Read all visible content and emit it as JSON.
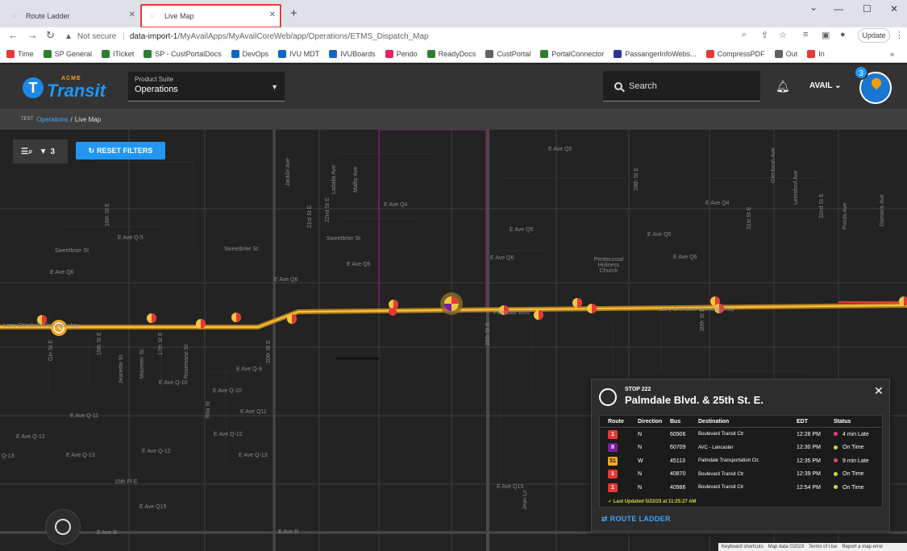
{
  "browser": {
    "tabs": [
      {
        "label": "Route Ladder"
      },
      {
        "label": "Live Map"
      }
    ],
    "new_tab_icon": "+",
    "security_label": "Not secure",
    "url_host": "data-import-1",
    "url_path": "/MyAvailApps/MyAvailCoreWeb/app/Operations/ETMS_Dispatch_Map",
    "update_label": "Update",
    "bookmarks": [
      {
        "label": "Time",
        "color": "#e53935"
      },
      {
        "label": "SP General",
        "color": "#2e7d32"
      },
      {
        "label": "ITicket",
        "color": "#2e7d32"
      },
      {
        "label": "SP - CustPortalDocs",
        "color": "#2e7d32"
      },
      {
        "label": "DevOps",
        "color": "#1565c0"
      },
      {
        "label": "IVU MDT",
        "color": "#1565c0"
      },
      {
        "label": "IVUBoards",
        "color": "#1565c0"
      },
      {
        "label": "Pendo",
        "color": "#e91e63"
      },
      {
        "label": "ReadyDocs",
        "color": "#2e7d32"
      },
      {
        "label": "CustPortal",
        "color": "#616161"
      },
      {
        "label": "PortalConnector",
        "color": "#2e7d32"
      },
      {
        "label": "PassangerInfoWebs...",
        "color": "#283593"
      },
      {
        "label": "CompressPDF",
        "color": "#e53935"
      },
      {
        "label": "Out",
        "color": "#616161"
      },
      {
        "label": "In",
        "color": "#e53935"
      }
    ],
    "more_bookmarks": "»"
  },
  "header": {
    "logo_top": "ACME",
    "logo_main": "Transit",
    "suite_label": "Product Suite",
    "suite_value": "Operations",
    "search_placeholder": "Search",
    "user_label": "AVAIL",
    "notification_count": "3"
  },
  "breadcrumb": {
    "env": "TEST",
    "parent": "Operations",
    "separator": "/",
    "current": "Live Map"
  },
  "toolbar": {
    "filter_count": "3",
    "reset_label": "RESET FILTERS"
  },
  "map_labels": [
    "E Ave Q2",
    "E Ave Q4",
    "E Ave Q-5",
    "E Ave Q5",
    "E Ave Q6",
    "E Ave Q6",
    "E Ave Q4",
    "E Ave Q5",
    "E Ave Q6",
    "Sweetbrier St",
    "Sweetbrier St",
    "Sweetbrier St",
    "E Ave Q6",
    "E Ave Q6",
    "Palmdale Blvd",
    "Larry Chimbole Memorial Hwy",
    "Larry Chimbole Memorial Hwy",
    "E Ave Q-9",
    "E Ave Q-10",
    "E Ave Q-10",
    "E Ave Q11",
    "E Ave Q-11",
    "E Ave Q-12",
    "E Ave Q-12",
    "E Ave Q-12",
    "E Ave Q-13",
    "E Ave Q-13",
    "15th Pl E",
    "E Ave Q15",
    "E Ave Q15",
    "E Ave R",
    "E Ave R",
    "Q-13",
    "20th St E",
    "25th St E",
    "30th St E",
    "15th St E",
    "17th St E",
    "18th St E",
    "21st St E",
    "22nd St E",
    "28th St E",
    "31st St E",
    "32nd St E",
    "Lemsford Ave",
    "Damaris Ave",
    "Ponds Ave",
    "Maureen St",
    "Rosemarie St",
    "Jeanette St",
    "Jacklin Ave",
    "Ladalla Ave",
    "Malby Ave",
    "Glenbush Ave",
    "Rita St",
    "Jean Ln",
    "Pentecostal Holiness Church",
    "Gin St E"
  ],
  "stop_popup": {
    "stop_number": "STOP 222",
    "stop_name": "Palmdale Blvd. & 25th St. E.",
    "columns": [
      "Route",
      "Direction",
      "Bus",
      "Destination",
      "EDT",
      "Status"
    ],
    "rows": [
      {
        "route": "1",
        "route_color": "#e53935",
        "direction": "N",
        "bus": "60906",
        "destination": "Boulevard Transit Ctr",
        "edt": "12:28 PM",
        "status": "4 min Late",
        "status_color": "#ec407a"
      },
      {
        "route": "8",
        "route_color": "#7b1fa2",
        "direction": "N",
        "bus": "60709",
        "destination": "AVC - Lancaster",
        "edt": "12:30 PM",
        "status": "On Time",
        "status_color": "#cddc39"
      },
      {
        "route": "51",
        "route_color": "#f9a825",
        "direction": "W",
        "bus": "45113",
        "destination": "Palmdale Transportation Ctr.",
        "edt": "12:35 PM",
        "status": "9 min Late",
        "status_color": "#ec407a"
      },
      {
        "route": "1",
        "route_color": "#e53935",
        "direction": "N",
        "bus": "40870",
        "destination": "Boulevard Transit Ctr",
        "edt": "12:39 PM",
        "status": "On Time",
        "status_color": "#cddc39"
      },
      {
        "route": "1",
        "route_color": "#e53935",
        "direction": "N",
        "bus": "40986",
        "destination": "Boulevard Transit Ctr",
        "edt": "12:54 PM",
        "status": "On Time",
        "status_color": "#cddc39"
      }
    ],
    "last_updated": "Last Updated 5/22/23 at 11:25:27 AM",
    "route_ladder_label": "ROUTE LADDER"
  },
  "map_footer": [
    "Keyboard shortcuts",
    "Map data ©2023",
    "Terms of Use",
    "Report a map error"
  ]
}
